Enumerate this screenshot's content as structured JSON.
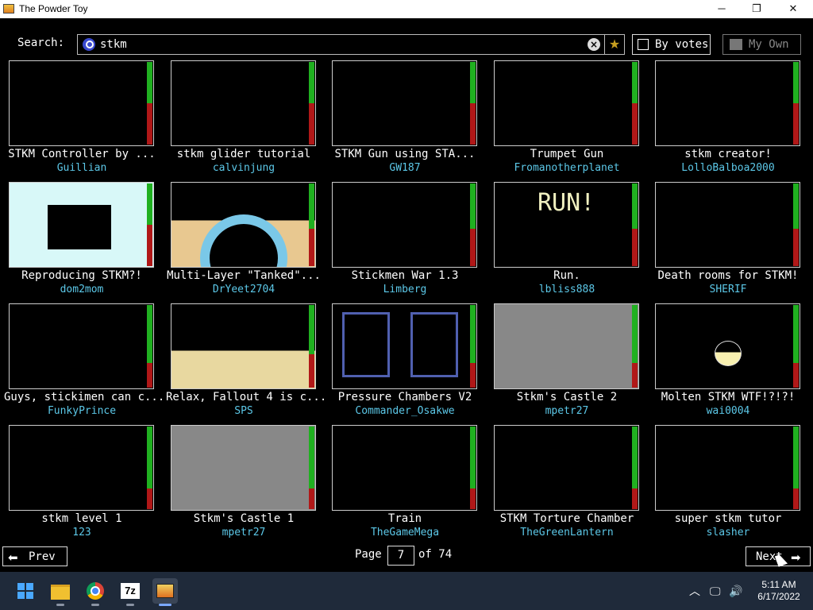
{
  "window": {
    "title": "The Powder Toy",
    "minimize": "─",
    "maximize": "❐",
    "close": "✕"
  },
  "search": {
    "label": "Search:",
    "query": "stkm",
    "clear_icon": "close-icon",
    "favorite_icon": "star-icon"
  },
  "toolbar": {
    "sort_label": "By votes",
    "own_label": "My Own"
  },
  "saves": [
    {
      "title": "STKM Controller by ...",
      "author": "Guillian",
      "up": 0.5
    },
    {
      "title": "stkm glider tutorial",
      "author": "calvinjung",
      "up": 0.5
    },
    {
      "title": "STKM Gun using STA...",
      "author": "GW187",
      "up": 0.5
    },
    {
      "title": "Trumpet Gun",
      "author": "Fromanotherplanet",
      "up": 0.5
    },
    {
      "title": "stkm creator!",
      "author": "LolloBalboa2000",
      "up": 0.5
    },
    {
      "title": "Reproducing STKM?!",
      "author": "dom2mom",
      "up": 0.5
    },
    {
      "title": "Multi-Layer \"Tanked\"...",
      "author": "DrYeet2704",
      "up": 0.55
    },
    {
      "title": "Stickmen War 1.3",
      "author": "Limberg",
      "up": 0.55
    },
    {
      "title": "Run.",
      "author": "lbliss888",
      "up": 0.55
    },
    {
      "title": "Death rooms for STKM!",
      "author": "SHERIF",
      "up": 0.55
    },
    {
      "title": "Guys, stickimen can c...",
      "author": "FunkyPrince",
      "up": 0.7
    },
    {
      "title": "Relax, Fallout 4 is c...",
      "author": "SPS",
      "up": 0.6
    },
    {
      "title": "Pressure Chambers V2",
      "author": "Commander_Osakwe",
      "up": 0.7
    },
    {
      "title": "Stkm's Castle 2",
      "author": "mpetr27",
      "up": 0.7
    },
    {
      "title": "Molten STKM WTF!?!?!",
      "author": "wai0004",
      "up": 0.7
    },
    {
      "title": "stkm level 1",
      "author": "123",
      "up": 0.75
    },
    {
      "title": "Stkm's Castle 1",
      "author": "mpetr27",
      "up": 0.75
    },
    {
      "title": "Train",
      "author": "TheGameMega",
      "up": 0.75
    },
    {
      "title": "STKM Torture Chamber",
      "author": "TheGreenLantern",
      "up": 0.75
    },
    {
      "title": "super stkm tutor",
      "author": "slasher",
      "up": 0.75
    }
  ],
  "pagination": {
    "prev_label": "Prev",
    "next_label": "Next",
    "page_label": "Page",
    "current_page": "7",
    "of_label": "of 74"
  },
  "taskbar": {
    "apps": [
      "start-icon",
      "file-explorer-icon",
      "chrome-icon",
      "7zip-icon",
      "powder-toy-icon"
    ],
    "zip_label": "7z",
    "time": "5:11 AM",
    "date": "6/17/2022"
  },
  "colors": {
    "vote_up": "#20b020",
    "vote_down": "#b01818",
    "author": "#5cc8e8"
  }
}
